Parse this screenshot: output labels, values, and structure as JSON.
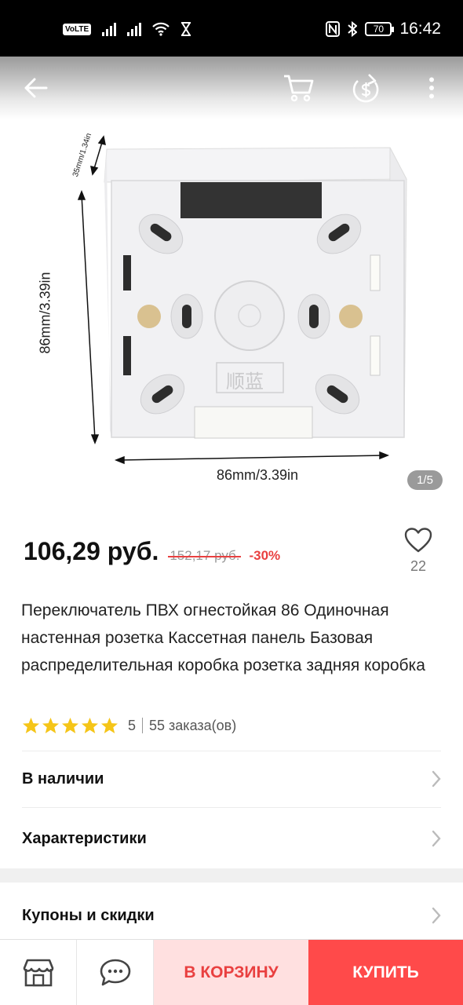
{
  "status_bar": {
    "volte": "VoLTE",
    "battery": "70",
    "time": "16:42"
  },
  "gallery": {
    "counter": "1/5",
    "dim_height": "86mm/3.39in",
    "dim_width": "86mm/3.39in",
    "dim_depth": "35mm/1.34in",
    "brand_mark": "顺蓝"
  },
  "price": {
    "current": "106,29 руб.",
    "old": "152,17 руб.",
    "discount": "-30%",
    "favorites_count": "22"
  },
  "product": {
    "title": "Переключатель ПВХ огнестойкая 86 Одиночная настенная розетка Кассетная панель Базовая распределительная коробка розетка задняя коробка",
    "rating": "5",
    "orders": "55 заказа(ов)",
    "rating_stars": 5
  },
  "rows": {
    "availability": "В наличии",
    "specs": "Характеристики",
    "coupons": "Купоны и скидки"
  },
  "bottom": {
    "cart": "В КОРЗИНУ",
    "buy": "КУПИТЬ"
  },
  "colors": {
    "accent": "#ff4a4a",
    "discount": "#e94040",
    "star": "#f5c518"
  }
}
